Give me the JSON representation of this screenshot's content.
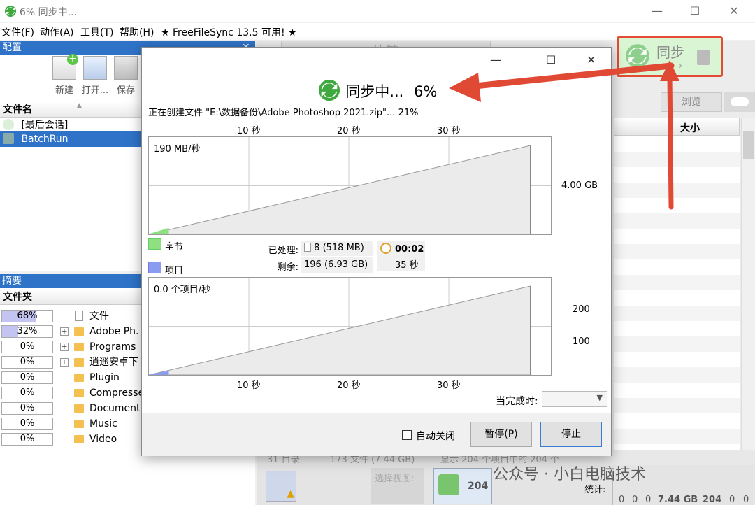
{
  "window": {
    "title": "6% 同步中...",
    "min": "—",
    "max": "☐",
    "close": "✕"
  },
  "menu": {
    "file": "文件(F)",
    "action": "动作(A)",
    "tools": "工具(T)",
    "help": "帮助(H)",
    "update_notice": "★ FreeFileSync 13.5 可用! ★"
  },
  "config_panel": {
    "title": "配置",
    "close": "✕",
    "new_label": "新建",
    "open_label": "打开...",
    "save_label": "保存",
    "list_header": "文件名",
    "items": [
      "[最后会话]",
      "BatchRun"
    ]
  },
  "summary_panel": {
    "title": "摘要",
    "list_header": "文件夹",
    "rows": [
      {
        "pct": "68%",
        "fill": 0.68,
        "expand": "",
        "icon": "file",
        "name": "文件"
      },
      {
        "pct": "32%",
        "fill": 0.32,
        "expand": "+",
        "icon": "folder",
        "name": "Adobe Ph."
      },
      {
        "pct": "0%",
        "fill": 0,
        "expand": "+",
        "icon": "folder",
        "name": "Programs"
      },
      {
        "pct": "0%",
        "fill": 0,
        "expand": "+",
        "icon": "folder",
        "name": "逍遥安卓下"
      },
      {
        "pct": "0%",
        "fill": 0,
        "expand": "",
        "icon": "folder",
        "name": "Plugin"
      },
      {
        "pct": "0%",
        "fill": 0,
        "expand": "",
        "icon": "folder",
        "name": "Compresse"
      },
      {
        "pct": "0%",
        "fill": 0,
        "expand": "",
        "icon": "folder",
        "name": "Document"
      },
      {
        "pct": "0%",
        "fill": 0,
        "expand": "",
        "icon": "folder",
        "name": "Music"
      },
      {
        "pct": "0%",
        "fill": 0,
        "expand": "",
        "icon": "folder",
        "name": "Video"
      }
    ]
  },
  "main": {
    "compare_label": "比较",
    "sync_label": "同步",
    "browse_label": "浏览",
    "size_header": "大小",
    "status_dirs": "31 目录",
    "status_files": "173 文件 (7.44 GB)",
    "status_shown": "显示 204 个项目中的 204 个",
    "select_view": "选择视图:",
    "count_badge": "204",
    "stats_label": "统计:",
    "stats_values": [
      "0",
      "0",
      "0",
      "7.44 GB",
      "204",
      "0",
      "0"
    ]
  },
  "dialog": {
    "title": "同步中...",
    "percent": "6%",
    "current_action": "正在创建文件 \"E:\\数据备份\\Adobe Photoshop 2021.zip\"... 21%",
    "time_ticks": [
      "10 秒",
      "20 秒",
      "30 秒"
    ],
    "bytes_rate": "190 MB/秒",
    "bytes_total": "4.00 GB",
    "items_rate": "0.0 个项目/秒",
    "items_ticks": [
      "200",
      "100"
    ],
    "legend_bytes": "字节",
    "legend_items": "项目",
    "processed_label": "已处理:",
    "processed_count": "8",
    "processed_size": "(518 MB)",
    "remaining_label": "剩余:",
    "remaining_count": "196",
    "remaining_size": "(6.93 GB)",
    "elapsed_time": "00:02",
    "remaining_time": "35 秒",
    "on_complete_label": "当完成时:",
    "auto_close_label": "自动关闭",
    "pause_label": "暂停(P)",
    "stop_label": "停止",
    "max": "☐",
    "close": "✕",
    "min": "—"
  },
  "chart_data": [
    {
      "type": "area",
      "x": [
        0,
        2,
        39
      ],
      "values": [
        0,
        0.27,
        4.0
      ],
      "xlabel": "",
      "ylabel": "",
      "x_ticks": [
        "10 秒",
        "20 秒",
        "30 秒"
      ],
      "series": [
        {
          "name": "字节",
          "values": [
            0,
            0.27,
            4.0
          ]
        }
      ],
      "annotation": "190 MB/秒",
      "ylim": [
        0,
        4.0
      ]
    },
    {
      "type": "area",
      "x": [
        0,
        2,
        39
      ],
      "values": [
        0,
        8,
        204
      ],
      "x_ticks": [
        "10 秒",
        "20 秒",
        "30 秒"
      ],
      "series": [
        {
          "name": "项目",
          "values": [
            0,
            8,
            204
          ]
        }
      ],
      "annotation": "0.0 个项目/秒",
      "ylim": [
        0,
        204
      ]
    }
  ],
  "watermark": "公众号 · 小白电脑技术"
}
